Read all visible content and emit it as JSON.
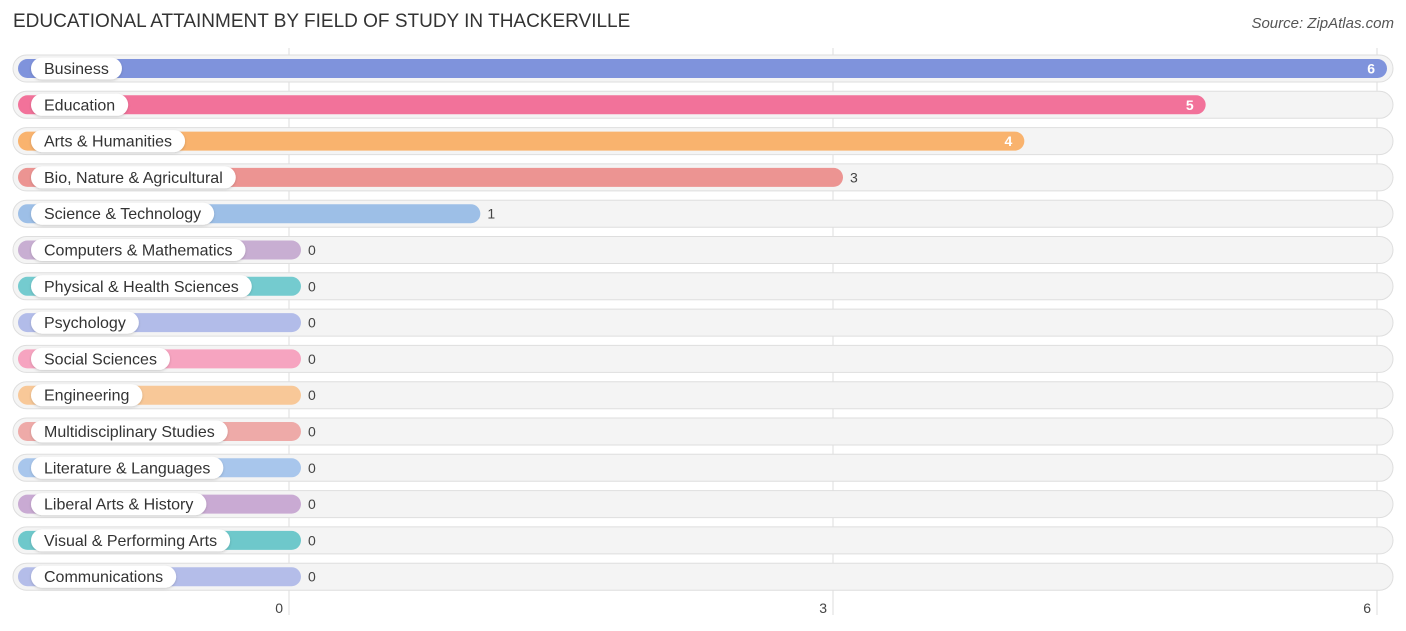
{
  "chart_data": {
    "type": "bar",
    "orientation": "horizontal",
    "title": "EDUCATIONAL ATTAINMENT BY FIELD OF STUDY IN THACKERVILLE",
    "source": "Source: ZipAtlas.com",
    "xlabel": "",
    "ylabel": "",
    "xlim": [
      0,
      6
    ],
    "xticks": [
      "0",
      "3",
      "6"
    ],
    "grid": true,
    "categories": [
      "Business",
      "Education",
      "Arts & Humanities",
      "Bio, Nature & Agricultural",
      "Science & Technology",
      "Computers & Mathematics",
      "Physical & Health Sciences",
      "Psychology",
      "Social Sciences",
      "Engineering",
      "Multidisciplinary Studies",
      "Literature & Languages",
      "Liberal Arts & History",
      "Visual & Performing Arts",
      "Communications"
    ],
    "values": [
      6,
      5,
      4,
      3,
      1,
      0,
      0,
      0,
      0,
      0,
      0,
      0,
      0,
      0,
      0
    ],
    "colors": [
      "#7f93dc",
      "#f2729a",
      "#f9b36e",
      "#ec9492",
      "#9dbfe7",
      "#c8aed2",
      "#74cbcf",
      "#b2bce9",
      "#f6a4c0",
      "#f8c898",
      "#eeaaa8",
      "#a8c6ec",
      "#c9aad3",
      "#6ec8cb",
      "#b4bde9"
    ]
  }
}
